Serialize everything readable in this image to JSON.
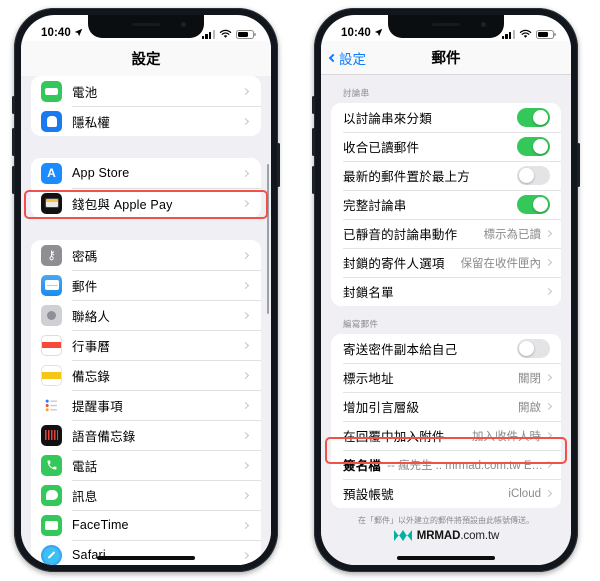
{
  "left_phone": {
    "status_bar": {
      "time": "10:40",
      "location_icon": "location-arrow-icon",
      "signal_icon": "cellular-signal-icon",
      "wifi_icon": "wifi-icon",
      "battery_icon": "battery-icon"
    },
    "nav": {
      "title": "設定"
    },
    "groups": [
      {
        "items": [
          {
            "label": "電池",
            "icon": "battery-app-icon"
          },
          {
            "label": "隱私權",
            "icon": "privacy-hand-icon"
          }
        ]
      },
      {
        "items": [
          {
            "label": "App Store",
            "icon": "app-store-icon"
          },
          {
            "label": "錢包與 Apple Pay",
            "icon": "wallet-icon"
          }
        ]
      },
      {
        "items": [
          {
            "label": "密碼",
            "icon": "password-key-icon"
          },
          {
            "label": "郵件",
            "icon": "mail-icon",
            "highlighted": true
          },
          {
            "label": "聯絡人",
            "icon": "contacts-icon"
          },
          {
            "label": "行事曆",
            "icon": "calendar-icon"
          },
          {
            "label": "備忘錄",
            "icon": "notes-icon"
          },
          {
            "label": "提醒事項",
            "icon": "reminders-icon"
          },
          {
            "label": "語音備忘錄",
            "icon": "voice-memos-icon"
          },
          {
            "label": "電話",
            "icon": "phone-icon"
          },
          {
            "label": "訊息",
            "icon": "messages-icon"
          },
          {
            "label": "FaceTime",
            "icon": "facetime-icon"
          },
          {
            "label": "Safari",
            "icon": "safari-icon"
          }
        ]
      }
    ]
  },
  "right_phone": {
    "status_bar": {
      "time": "10:40",
      "location_icon": "location-arrow-icon",
      "signal_icon": "cellular-signal-icon",
      "wifi_icon": "wifi-icon",
      "battery_icon": "battery-icon"
    },
    "nav": {
      "back_label": "設定",
      "title": "郵件"
    },
    "sections": [
      {
        "header": "討論串",
        "rows": [
          {
            "label": "以討論串來分類",
            "type": "toggle",
            "value": "on"
          },
          {
            "label": "收合已讀郵件",
            "type": "toggle",
            "value": "on"
          },
          {
            "label": "最新的郵件置於最上方",
            "type": "toggle",
            "value": "off"
          },
          {
            "label": "完整討論串",
            "type": "toggle",
            "value": "on"
          },
          {
            "label": "已靜音的討論串動作",
            "type": "value",
            "value": "標示為已讀"
          },
          {
            "label": "封鎖的寄件人選項",
            "type": "value",
            "value": "保留在收件匣內"
          },
          {
            "label": "封鎖名單",
            "type": "link",
            "value": ""
          }
        ]
      },
      {
        "header": "編寫郵件",
        "rows": [
          {
            "label": "寄送密件副本給自己",
            "type": "toggle",
            "value": "off"
          },
          {
            "label": "標示地址",
            "type": "value",
            "value": "關閉"
          },
          {
            "label": "增加引言層級",
            "type": "value",
            "value": "開啟"
          },
          {
            "label": "在回覆中加入附件",
            "type": "value",
            "value": "加入收件人時"
          },
          {
            "label": "簽名檔",
            "type": "signature",
            "value": "-- 瘋先生 :: mrmad.com.tw Em…",
            "highlighted": true
          },
          {
            "label": "預設帳號",
            "type": "value",
            "value": "iCloud"
          }
        ],
        "footnote": "在「郵件」以外建立的郵件將預設由此帳號傳送。"
      }
    ]
  },
  "watermark": {
    "brand": "MRMAD",
    "suffix": ".com.tw",
    "mark_color": "#00b3a4"
  },
  "colors": {
    "accent_blue": "#0a7cff",
    "toggle_green": "#34c759",
    "highlight_red": "#f4504a",
    "page_bg": "#efeff4"
  }
}
